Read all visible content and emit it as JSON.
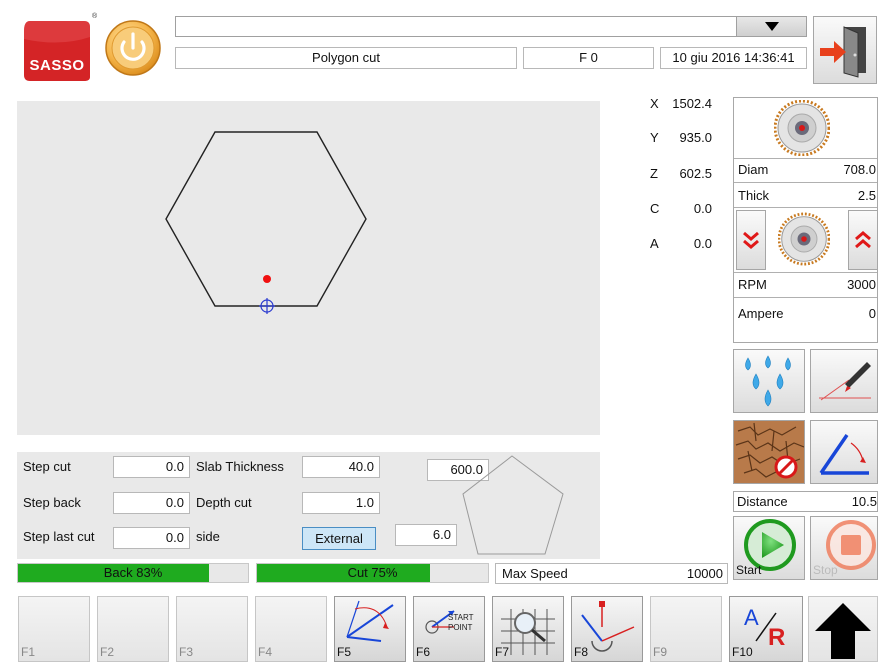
{
  "header": {
    "brand": "SASSO",
    "program_name": "Polygon cut",
    "feed": "F 0",
    "datetime": "10 giu 2016 14:36:41",
    "dropdown_value": ""
  },
  "axes": [
    {
      "label": "X",
      "value": "1502.4"
    },
    {
      "label": "Y",
      "value": "935.0"
    },
    {
      "label": "Z",
      "value": "602.5"
    },
    {
      "label": "C",
      "value": "0.0"
    },
    {
      "label": "A",
      "value": "0.0"
    }
  ],
  "blade": {
    "diam_label": "Diam",
    "diam_value": "708.0",
    "thick_label": "Thick",
    "thick_value": "2.5",
    "rpm_label": "RPM",
    "rpm_value": "3000",
    "ampere_label": "Ampere",
    "ampere_value": "0"
  },
  "distance": {
    "label": "Distance",
    "value": "10.5"
  },
  "start_label": "Start",
  "stop_label": "Stop",
  "params": {
    "step_cut_label": "Step cut",
    "step_cut_value": "0.0",
    "step_back_label": "Step back",
    "step_back_value": "0.0",
    "step_last_label": "Step last cut",
    "step_last_value": "0.0",
    "slab_label": "Slab Thickness",
    "slab_value": "40.0",
    "depth_label": "Depth cut",
    "depth_value": "1.0",
    "side_label": "side",
    "side_value": "External",
    "size_value": "600.0",
    "sides_value": "6.0"
  },
  "progress": {
    "back_text": "Back 83%",
    "back_fraction": 0.83,
    "cut_text": "Cut 75%",
    "cut_fraction": 0.75
  },
  "max_speed": {
    "label": "Max Speed",
    "value": "10000"
  },
  "fkeys": {
    "f1": "F1",
    "f2": "F2",
    "f3": "F3",
    "f4": "F4",
    "f5": "F5",
    "f6": "F6",
    "f6_text1": "START",
    "f6_text2": "POINT",
    "f7": "F7",
    "f8": "F8",
    "f9": "F9",
    "f10": "F10"
  },
  "colors": {
    "progress_green": "#1fab1f",
    "brand_red": "#d42426",
    "power_orange": "#f0a030",
    "external_button": "#cde6f7"
  }
}
